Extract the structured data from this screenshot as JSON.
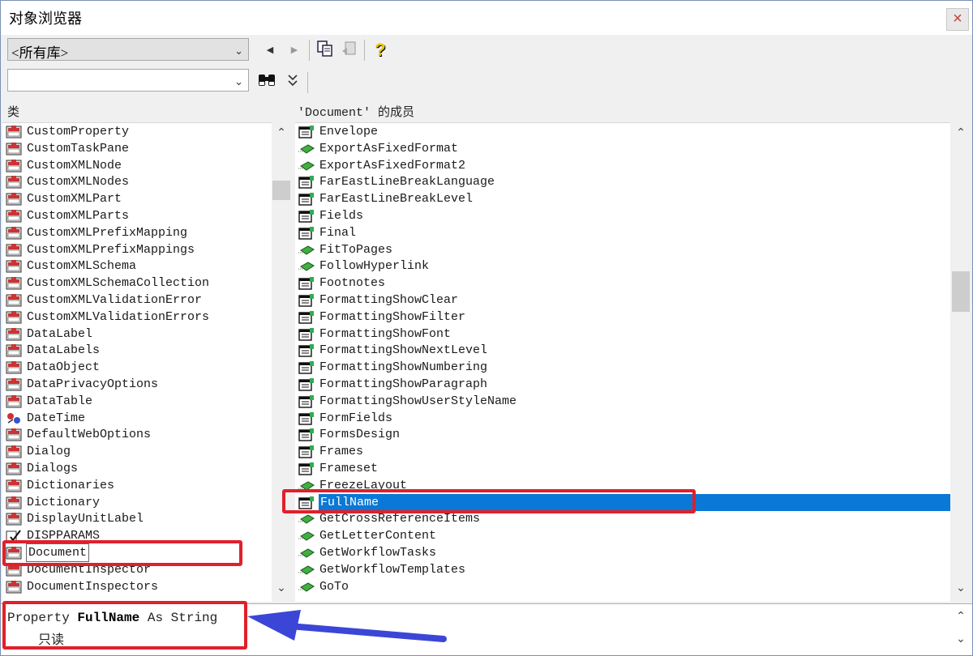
{
  "window": {
    "title": "对象浏览器",
    "close_glyph": "×"
  },
  "toolbar": {
    "library_combo_value": "<所有库>",
    "search_value": "",
    "back_glyph": "◀",
    "forward_glyph": "▶",
    "help_glyph": "?",
    "search_glyph": "⛶",
    "expand_glyph": "⌄"
  },
  "classes": {
    "header": "类",
    "items": [
      {
        "label": "CustomProperty",
        "icon": "class-icon"
      },
      {
        "label": "CustomTaskPane",
        "icon": "class-icon"
      },
      {
        "label": "CustomXMLNode",
        "icon": "class-icon"
      },
      {
        "label": "CustomXMLNodes",
        "icon": "class-icon"
      },
      {
        "label": "CustomXMLPart",
        "icon": "class-icon"
      },
      {
        "label": "CustomXMLParts",
        "icon": "class-icon"
      },
      {
        "label": "CustomXMLPrefixMapping",
        "icon": "class-icon"
      },
      {
        "label": "CustomXMLPrefixMappings",
        "icon": "class-icon"
      },
      {
        "label": "CustomXMLSchema",
        "icon": "class-icon"
      },
      {
        "label": "CustomXMLSchemaCollection",
        "icon": "class-icon"
      },
      {
        "label": "CustomXMLValidationError",
        "icon": "class-icon"
      },
      {
        "label": "CustomXMLValidationErrors",
        "icon": "class-icon"
      },
      {
        "label": "DataLabel",
        "icon": "class-icon"
      },
      {
        "label": "DataLabels",
        "icon": "class-icon"
      },
      {
        "label": "DataObject",
        "icon": "class-icon"
      },
      {
        "label": "DataPrivacyOptions",
        "icon": "class-icon"
      },
      {
        "label": "DataTable",
        "icon": "class-icon"
      },
      {
        "label": "DateTime",
        "icon": "module-icon"
      },
      {
        "label": "DefaultWebOptions",
        "icon": "class-icon"
      },
      {
        "label": "Dialog",
        "icon": "class-icon"
      },
      {
        "label": "Dialogs",
        "icon": "class-icon"
      },
      {
        "label": "Dictionaries",
        "icon": "class-icon"
      },
      {
        "label": "Dictionary",
        "icon": "class-icon"
      },
      {
        "label": "DisplayUnitLabel",
        "icon": "class-icon"
      },
      {
        "label": "DISPPARAMS",
        "icon": "type-icon"
      },
      {
        "label": "Document",
        "icon": "class-icon",
        "focused": true
      },
      {
        "label": "DocumentInspector",
        "icon": "class-icon"
      },
      {
        "label": "DocumentInspectors",
        "icon": "class-icon"
      }
    ]
  },
  "members": {
    "header": "'Document' 的成员",
    "items": [
      {
        "label": "Envelope",
        "icon": "property-icon"
      },
      {
        "label": "ExportAsFixedFormat",
        "icon": "method-icon"
      },
      {
        "label": "ExportAsFixedFormat2",
        "icon": "method-icon"
      },
      {
        "label": "FarEastLineBreakLanguage",
        "icon": "property-icon"
      },
      {
        "label": "FarEastLineBreakLevel",
        "icon": "property-icon"
      },
      {
        "label": "Fields",
        "icon": "property-icon"
      },
      {
        "label": "Final",
        "icon": "property-icon"
      },
      {
        "label": "FitToPages",
        "icon": "method-icon"
      },
      {
        "label": "FollowHyperlink",
        "icon": "method-icon"
      },
      {
        "label": "Footnotes",
        "icon": "property-icon"
      },
      {
        "label": "FormattingShowClear",
        "icon": "property-icon"
      },
      {
        "label": "FormattingShowFilter",
        "icon": "property-icon"
      },
      {
        "label": "FormattingShowFont",
        "icon": "property-icon"
      },
      {
        "label": "FormattingShowNextLevel",
        "icon": "property-icon"
      },
      {
        "label": "FormattingShowNumbering",
        "icon": "property-icon"
      },
      {
        "label": "FormattingShowParagraph",
        "icon": "property-icon"
      },
      {
        "label": "FormattingShowUserStyleName",
        "icon": "property-icon"
      },
      {
        "label": "FormFields",
        "icon": "property-icon"
      },
      {
        "label": "FormsDesign",
        "icon": "property-icon"
      },
      {
        "label": "Frames",
        "icon": "property-icon"
      },
      {
        "label": "Frameset",
        "icon": "property-icon"
      },
      {
        "label": "FreezeLayout",
        "icon": "method-icon"
      },
      {
        "label": "FullName",
        "icon": "property-icon",
        "selected": true
      },
      {
        "label": "GetCrossReferenceItems",
        "icon": "method-icon"
      },
      {
        "label": "GetLetterContent",
        "icon": "method-icon"
      },
      {
        "label": "GetWorkflowTasks",
        "icon": "method-icon"
      },
      {
        "label": "GetWorkflowTemplates",
        "icon": "method-icon"
      },
      {
        "label": "GoTo",
        "icon": "method-icon"
      }
    ]
  },
  "details": {
    "prefix": "Property",
    "name": "FullName",
    "suffix": "As String",
    "note": "只读"
  },
  "colors": {
    "selection": "#0a78d6",
    "highlight_box": "#e0202a",
    "arrow": "#3b46d6"
  }
}
